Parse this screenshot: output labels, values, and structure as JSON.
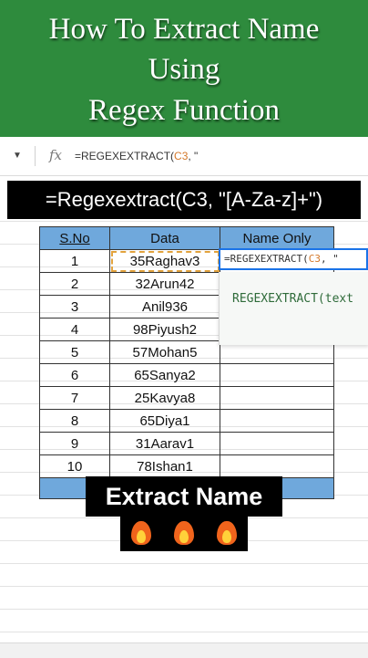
{
  "banner": {
    "line1": "How To Extract Name",
    "line2": "Using",
    "line3": "Regex Function",
    "bg_color": "#2e8b3d"
  },
  "formula_bar": {
    "fx_label": "fx",
    "formula_prefix": "=REGEXEXTRACT(",
    "formula_ref": "C3",
    "formula_suffix": ", \""
  },
  "caption": "=Regexextract(C3, \"[A-Za-z]+\")",
  "table": {
    "headers": [
      "S.No",
      "Data",
      "Name Only"
    ],
    "rows": [
      {
        "sno": "1",
        "data": "35Raghav3"
      },
      {
        "sno": "2",
        "data": "32Arun42"
      },
      {
        "sno": "3",
        "data": "Anil936"
      },
      {
        "sno": "4",
        "data": "98Piyush2"
      },
      {
        "sno": "5",
        "data": "57Mohan5"
      },
      {
        "sno": "6",
        "data": "65Sanya2"
      },
      {
        "sno": "7",
        "data": "25Kavya8"
      },
      {
        "sno": "8",
        "data": "65Diya1"
      },
      {
        "sno": "9",
        "data": "31Aarav1"
      },
      {
        "sno": "10",
        "data": "78Ishan1"
      }
    ],
    "header_color": "#6fa8dc"
  },
  "cell_editor": {
    "prefix": "=REGEXEXTRACT(",
    "ref": "C3",
    "suffix": ", \""
  },
  "autocomplete": {
    "hint": "REGEXEXTRACT(text"
  },
  "overlay": {
    "title": "Extract Name",
    "icons": [
      "fire-icon",
      "fire-icon",
      "fire-icon"
    ]
  }
}
